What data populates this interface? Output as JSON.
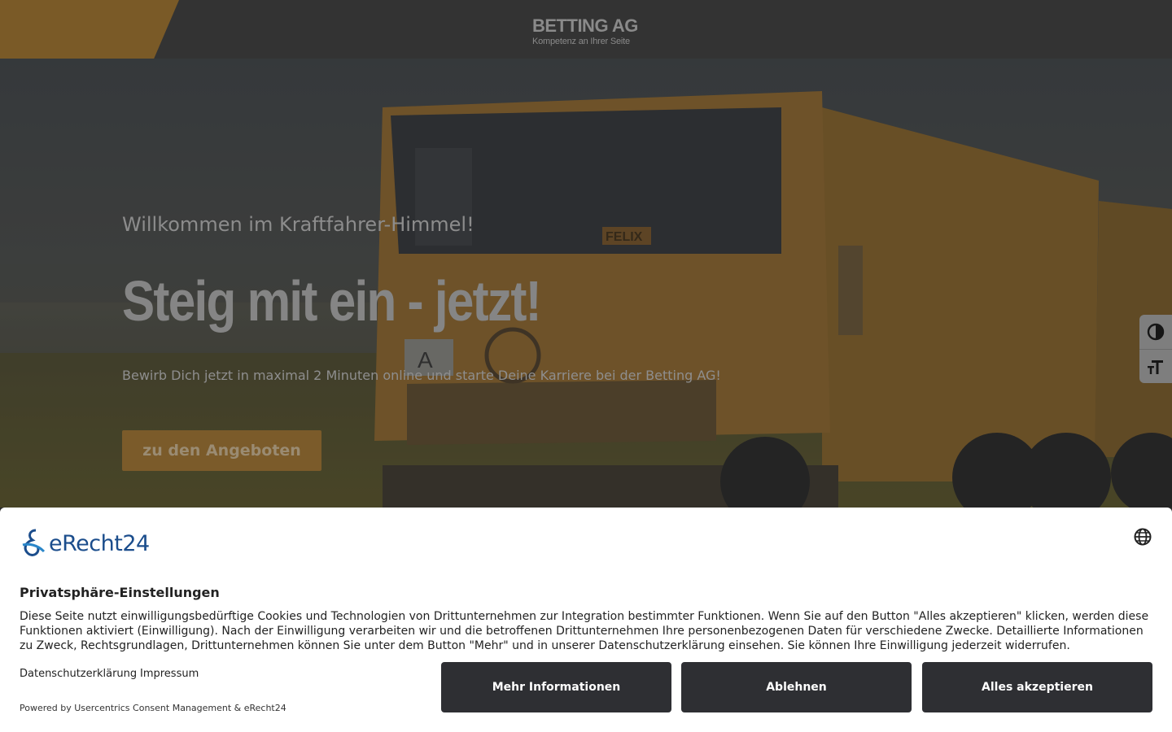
{
  "header": {
    "logo_title": "BETTING AG",
    "logo_subtitle": "Kompetenz an Ihrer Seite",
    "accent_color": "#7a5a27"
  },
  "hero": {
    "kicker": "Willkommen im Kraftfahrer-Himmel!",
    "title": "Steig mit ein - jetzt!",
    "text": "Bewirb Dich jetzt in maximal 2 Minuten online und starte Deine Karriere bei der Betting AG!",
    "button_label": "zu den Angeboten",
    "truck_plate": "FELIX",
    "truck_sign": "A"
  },
  "accessibility": {
    "contrast_icon": "contrast-icon",
    "font_size_icon": "font-size-icon"
  },
  "consent": {
    "brand": "eRecht24",
    "title": "Privatsphäre-Einstellungen",
    "text": "Diese Seite nutzt einwilligungsbedürftige Cookies und Technologien von Drittunternehmen zur Integration bestimmter Funktionen. Wenn Sie auf den Button \"Alles akzeptieren\" klicken, werden diese Funktionen aktiviert (Einwilligung). Nach der Einwilligung verarbeiten wir und die betroffenen Drittunternehmen Ihre personenbezogenen Daten für verschiedene Zwecke. Detaillierte Informationen zu Zweck, Rechtsgrundlagen, Drittunternehmen können Sie unter dem Button \"Mehr\" und in unserer Datenschutzerklärung einsehen. Sie können Ihre Einwilligung jederzeit widerrufen.",
    "links": [
      "Datenschutzerklärung",
      "Impressum"
    ],
    "powered_by": "Powered by Usercentrics Consent Management & eRecht24",
    "buttons": {
      "more": "Mehr Informationen",
      "decline": "Ablehnen",
      "accept": "Alles akzeptieren"
    },
    "button_color": "#2e2f33"
  }
}
